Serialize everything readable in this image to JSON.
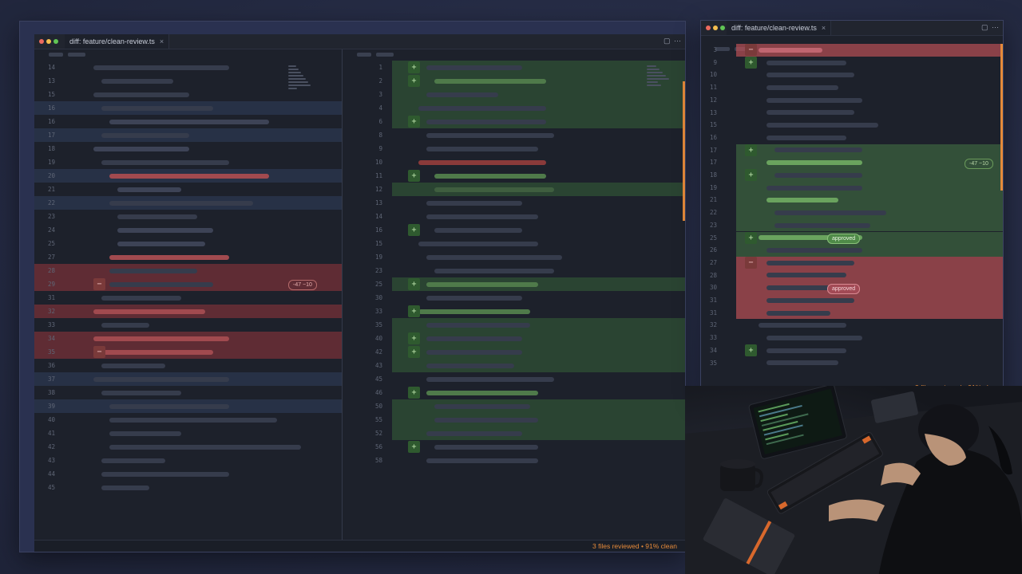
{
  "app_icon": "rocket-icon",
  "main_window": {
    "tab_label": "diff: feature/clean-review.ts",
    "tab_close": "×",
    "left_pane": {
      "line_numbers": [
        "14",
        "13",
        "15",
        "16",
        "16",
        "17",
        "18",
        "19",
        "20",
        "21",
        "22",
        "23",
        "24",
        "25",
        "27",
        "28",
        "29",
        "31",
        "32",
        "33",
        "34",
        "35",
        "36",
        "37",
        "38",
        "39",
        "40",
        "41",
        "42",
        "43",
        "44",
        "45"
      ],
      "collapse_badge": "-47 −10"
    },
    "right_pane": {
      "line_numbers": [
        "1",
        "2",
        "3",
        "4",
        "6",
        "8",
        "9",
        "10",
        "11",
        "12",
        "13",
        "14",
        "16",
        "15",
        "19",
        "23",
        "25",
        "30",
        "33",
        "35",
        "40",
        "42",
        "43",
        "45",
        "46",
        "50",
        "55",
        "52",
        "56",
        "58"
      ]
    },
    "status_text": "3 files reviewed  •  91% clean"
  },
  "side_window": {
    "tab_label": "diff: feature/clean-review.ts",
    "tab_close": "×",
    "line_numbers": [
      "3",
      "9",
      "10",
      "11",
      "12",
      "13",
      "15",
      "16",
      "17",
      "17",
      "18",
      "19",
      "21",
      "22",
      "23",
      "25",
      "26",
      "27",
      "28",
      "30",
      "31",
      "31",
      "32",
      "33",
      "34",
      "35"
    ],
    "collapse_badge": "-47 −10",
    "approved_label_1": "approved",
    "approved_label_2": "approved",
    "status_text": "3 files reviewed  •  91% clean"
  },
  "colors": {
    "accent": "#e58a3a",
    "added_bg": "#2e4a32",
    "removed_bg": "#6a3038",
    "editor_bg": "#1d212b"
  }
}
